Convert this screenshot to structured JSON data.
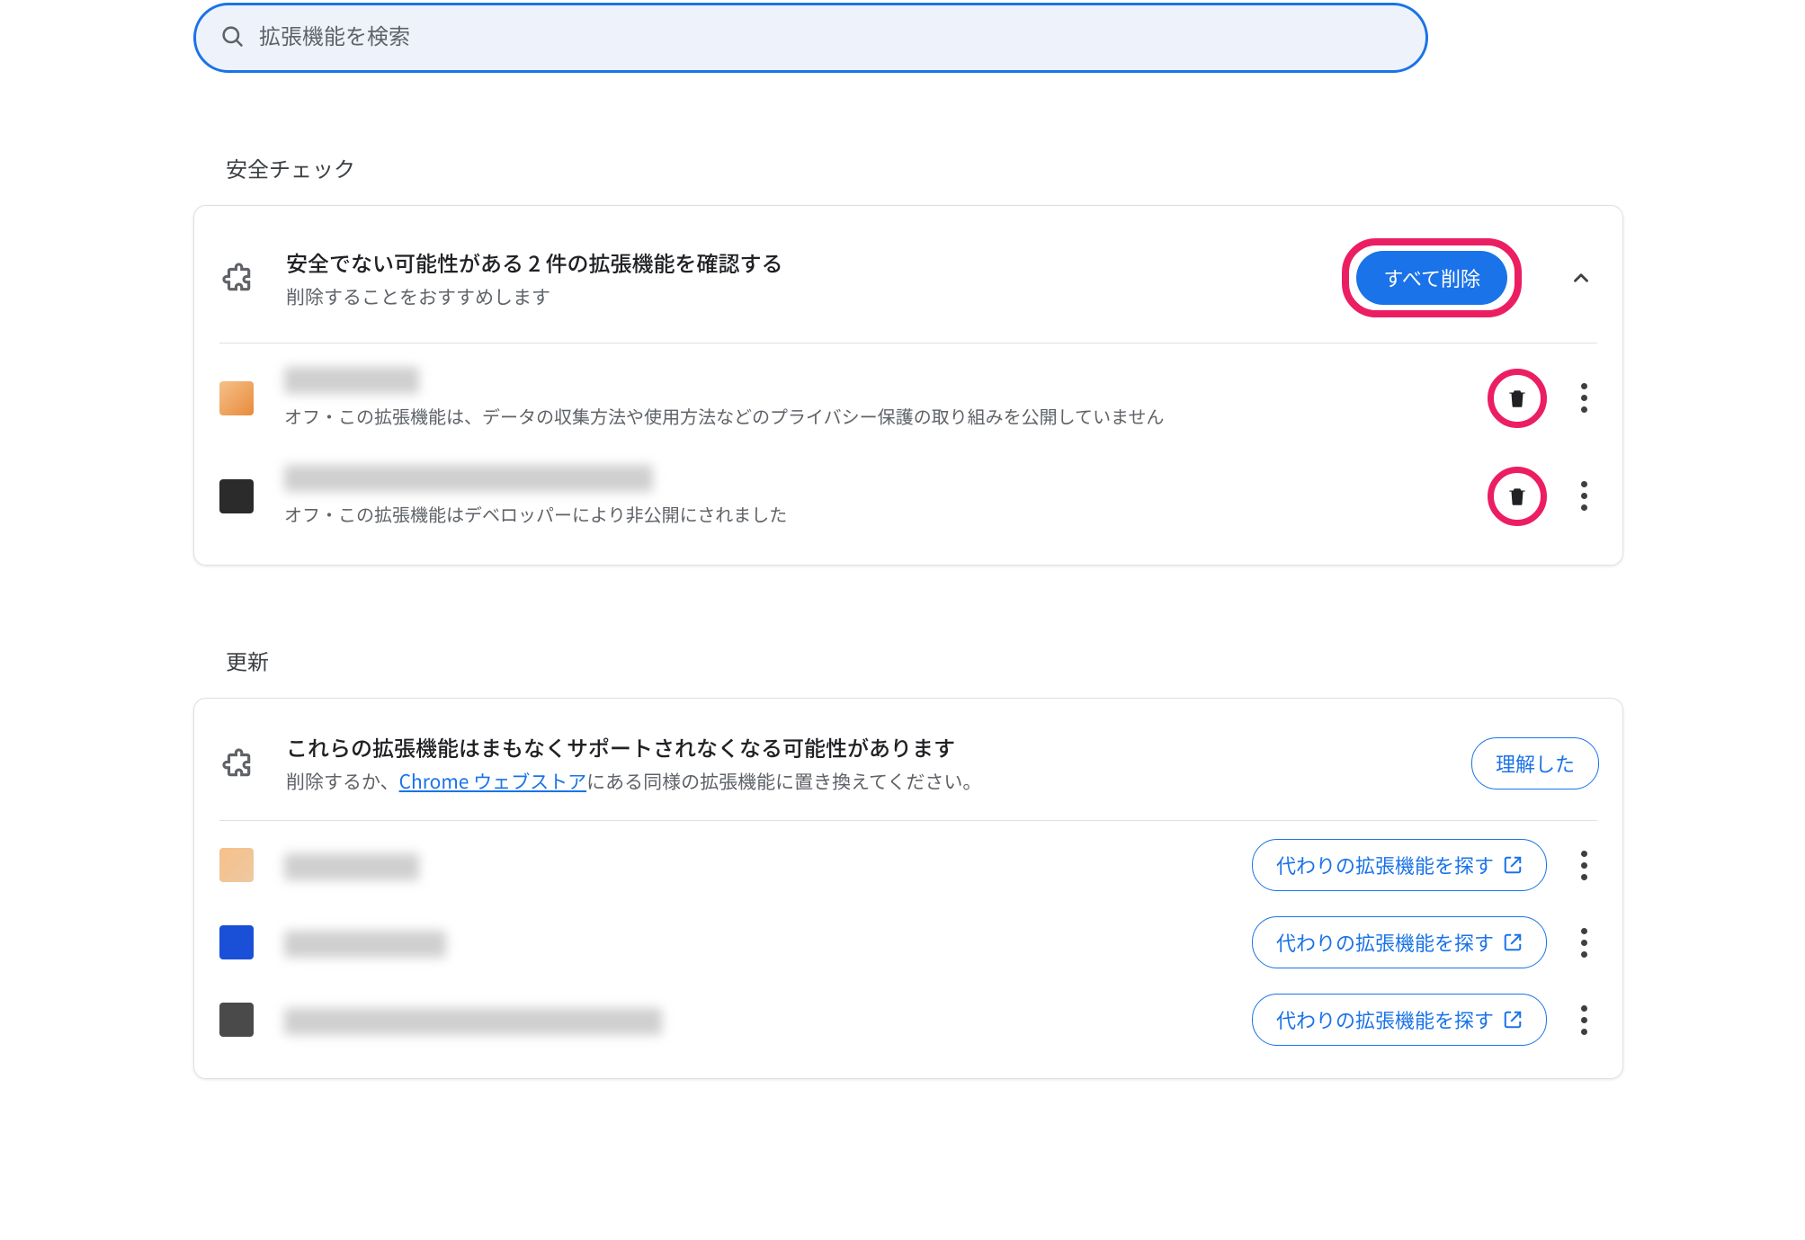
{
  "search": {
    "placeholder": "拡張機能を検索"
  },
  "sections": {
    "safety": {
      "title": "安全チェック",
      "header_title": "安全でない可能性がある 2 件の拡張機能を確認する",
      "header_sub": "削除することをおすすめします",
      "delete_all": "すべて削除",
      "items": [
        {
          "desc": "オフ・この拡張機能は、データの収集方法や使用方法などのプライバシー保護の取り組みを公開していません"
        },
        {
          "desc": "オフ・この拡張機能はデベロッパーにより非公開にされました"
        }
      ]
    },
    "updates": {
      "title": "更新",
      "header_title": "これらの拡張機能はまもなくサポートされなくなる可能性があります",
      "header_sub_prefix": "削除するか、",
      "header_sub_link": "Chrome ウェブストア",
      "header_sub_suffix": "にある同様の拡張機能に置き換えてください。",
      "understood": "理解した",
      "find_alt": "代わりの拡張機能を探す",
      "items": [
        {},
        {},
        {}
      ]
    }
  },
  "icons": {
    "search": "search-icon",
    "extension": "extension-icon",
    "chevron_up": "chevron-up-icon",
    "trash": "trash-icon",
    "kebab": "kebab-icon",
    "open_new": "open-in-new-icon"
  }
}
